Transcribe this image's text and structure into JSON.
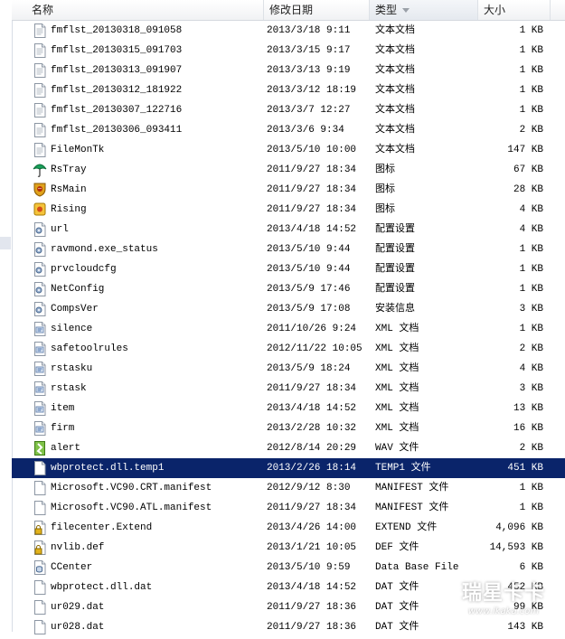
{
  "columns": {
    "name": "名称",
    "date": "修改日期",
    "type": "类型",
    "size": "大小"
  },
  "rows": [
    {
      "name": "fmflst_20130318_091058",
      "date": "2013/3/18 9:11",
      "type": "文本文档",
      "size": "1 KB",
      "icon": "text-file-icon"
    },
    {
      "name": "fmflst_20130315_091703",
      "date": "2013/3/15 9:17",
      "type": "文本文档",
      "size": "1 KB",
      "icon": "text-file-icon"
    },
    {
      "name": "fmflst_20130313_091907",
      "date": "2013/3/13 9:19",
      "type": "文本文档",
      "size": "1 KB",
      "icon": "text-file-icon"
    },
    {
      "name": "fmflst_20130312_181922",
      "date": "2013/3/12 18:19",
      "type": "文本文档",
      "size": "1 KB",
      "icon": "text-file-icon"
    },
    {
      "name": "fmflst_20130307_122716",
      "date": "2013/3/7 12:27",
      "type": "文本文档",
      "size": "1 KB",
      "icon": "text-file-icon"
    },
    {
      "name": "fmflst_20130306_093411",
      "date": "2013/3/6 9:34",
      "type": "文本文档",
      "size": "2 KB",
      "icon": "text-file-icon"
    },
    {
      "name": "FileMonTk",
      "date": "2013/5/10 10:00",
      "type": "文本文档",
      "size": "147 KB",
      "icon": "text-file-icon"
    },
    {
      "name": "RsTray",
      "date": "2011/9/27 18:34",
      "type": "图标",
      "size": "67 KB",
      "icon": "umbrella-icon"
    },
    {
      "name": "RsMain",
      "date": "2011/9/27 18:34",
      "type": "图标",
      "size": "28 KB",
      "icon": "lion-shield-icon"
    },
    {
      "name": "Rising",
      "date": "2011/9/27 18:34",
      "type": "图标",
      "size": "4 KB",
      "icon": "yellow-app-icon"
    },
    {
      "name": "url",
      "date": "2013/4/18 14:52",
      "type": "配置设置",
      "size": "4 KB",
      "icon": "config-file-icon"
    },
    {
      "name": "ravmond.exe_status",
      "date": "2013/5/10 9:44",
      "type": "配置设置",
      "size": "1 KB",
      "icon": "config-file-icon"
    },
    {
      "name": "prvcloudcfg",
      "date": "2013/5/10 9:44",
      "type": "配置设置",
      "size": "1 KB",
      "icon": "config-file-icon"
    },
    {
      "name": "NetConfig",
      "date": "2013/5/9 17:46",
      "type": "配置设置",
      "size": "1 KB",
      "icon": "config-file-icon"
    },
    {
      "name": "CompsVer",
      "date": "2013/5/9 17:08",
      "type": "安装信息",
      "size": "3 KB",
      "icon": "config-file-icon"
    },
    {
      "name": "silence",
      "date": "2011/10/26 9:24",
      "type": "XML 文档",
      "size": "1 KB",
      "icon": "xml-file-icon"
    },
    {
      "name": "safetoolrules",
      "date": "2012/11/22 10:05",
      "type": "XML 文档",
      "size": "2 KB",
      "icon": "xml-file-icon"
    },
    {
      "name": "rstasku",
      "date": "2013/5/9 18:24",
      "type": "XML 文档",
      "size": "4 KB",
      "icon": "xml-file-icon"
    },
    {
      "name": "rstask",
      "date": "2011/9/27 18:34",
      "type": "XML 文档",
      "size": "3 KB",
      "icon": "xml-file-icon"
    },
    {
      "name": "item",
      "date": "2013/4/18 14:52",
      "type": "XML 文档",
      "size": "13 KB",
      "icon": "xml-file-icon"
    },
    {
      "name": "firm",
      "date": "2013/2/28 10:32",
      "type": "XML 文档",
      "size": "16 KB",
      "icon": "xml-file-icon"
    },
    {
      "name": "alert",
      "date": "2012/8/14 20:29",
      "type": "WAV 文件",
      "size": "2 KB",
      "icon": "audio-file-icon"
    },
    {
      "name": "wbprotect.dll.temp1",
      "date": "2013/2/26 18:14",
      "type": "TEMP1 文件",
      "size": "451 KB",
      "icon": "blank-file-icon",
      "selected": true
    },
    {
      "name": "Microsoft.VC90.CRT.manifest",
      "date": "2012/9/12 8:30",
      "type": "MANIFEST 文件",
      "size": "1 KB",
      "icon": "blank-file-icon"
    },
    {
      "name": "Microsoft.VC90.ATL.manifest",
      "date": "2011/9/27 18:34",
      "type": "MANIFEST 文件",
      "size": "1 KB",
      "icon": "blank-file-icon"
    },
    {
      "name": "filecenter.Extend",
      "date": "2013/4/26 14:00",
      "type": "EXTEND 文件",
      "size": "4,096 KB",
      "icon": "locked-file-icon"
    },
    {
      "name": "nvlib.def",
      "date": "2013/1/21 10:05",
      "type": "DEF 文件",
      "size": "14,593 KB",
      "icon": "locked-file-icon"
    },
    {
      "name": "CCenter",
      "date": "2013/5/10 9:59",
      "type": "Data Base File",
      "size": "6 KB",
      "icon": "database-file-icon"
    },
    {
      "name": "wbprotect.dll.dat",
      "date": "2013/4/18 14:52",
      "type": "DAT 文件",
      "size": "452 KB",
      "icon": "blank-file-icon"
    },
    {
      "name": "ur029.dat",
      "date": "2011/9/27 18:36",
      "type": "DAT 文件",
      "size": "99 KB",
      "icon": "blank-file-icon"
    },
    {
      "name": "ur028.dat",
      "date": "2011/9/27 18:36",
      "type": "DAT 文件",
      "size": "143 KB",
      "icon": "blank-file-icon"
    }
  ],
  "watermark": {
    "title": "瑞星卡卡",
    "url": "www.ikaka.com"
  }
}
